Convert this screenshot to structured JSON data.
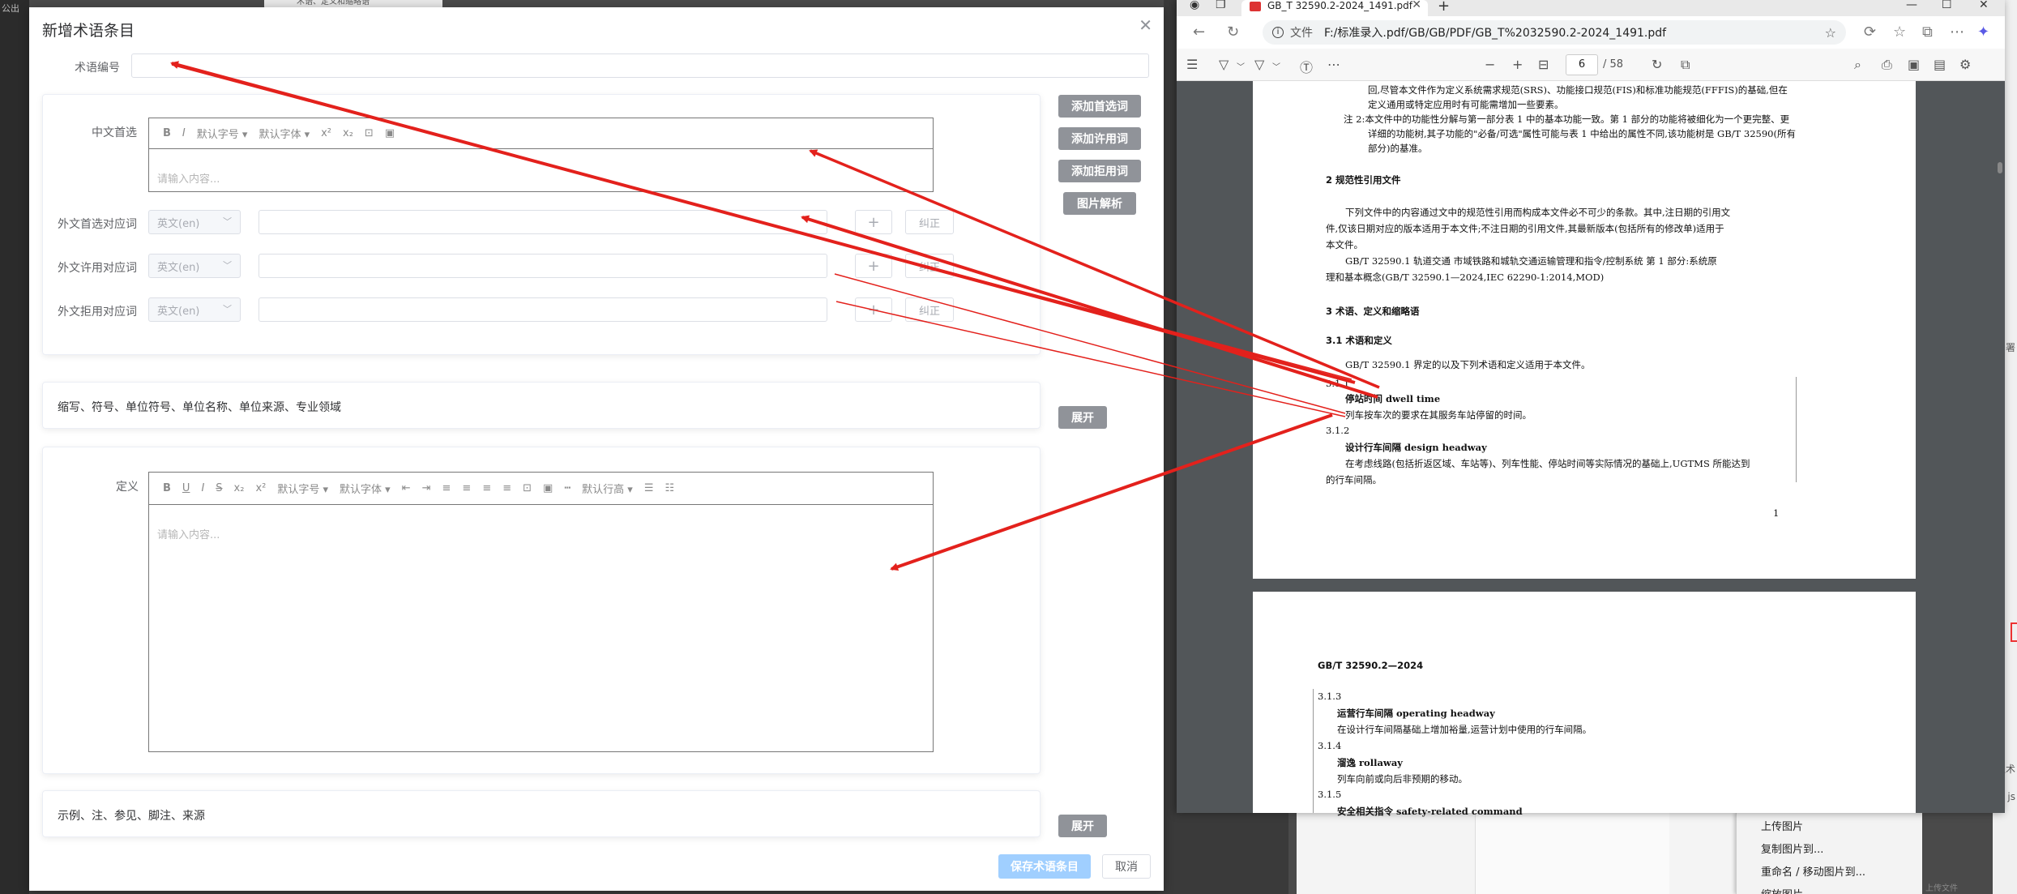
{
  "background": {
    "left_label": "公出",
    "tab_label": "术语、定义和缩略语",
    "ctx_menu": [
      "上传图片",
      "复制图片到...",
      "重命名 / 移动图片到...",
      "缩放图片"
    ],
    "right_strip": [
      "署",
      "之术",
      "js"
    ],
    "bottom_note": "上传文件"
  },
  "dialog": {
    "title": "新增术语条目",
    "close_icon": "close-icon",
    "term_number_label": "术语编号",
    "zh_preferred_label": "中文首选",
    "editor_placeholder": "请输入内容...",
    "toolbar1": [
      "B",
      "I",
      "默认字号 ▾",
      "默认字体 ▾",
      "x²",
      "x₂",
      "⊡",
      "▣"
    ],
    "foreign_rows": [
      {
        "label": "外文首选对应词",
        "lang": "英文(en)",
        "add": "+",
        "fix": "纠正"
      },
      {
        "label": "外文许用对应词",
        "lang": "英文(en)",
        "add": "+",
        "fix": "纠正"
      },
      {
        "label": "外文拒用对应词",
        "lang": "英文(en)",
        "add": "+",
        "fix": "纠正"
      }
    ],
    "side_buttons": [
      "添加首选词",
      "添加许用词",
      "添加拒用词",
      "图片解析"
    ],
    "abbrev_section": "缩写、符号、单位符号、单位名称、单位来源、专业领域",
    "expand_label": "展开",
    "definition_label": "定义",
    "toolbar2": [
      "B",
      "U",
      "I",
      "S",
      "x₂",
      "x²",
      "默认字号 ▾",
      "默认字体 ▾",
      "⇤",
      "⇥",
      "≡",
      "≡",
      "≡",
      "≡",
      "⊡",
      "▣",
      "┅",
      "默认行高 ▾",
      "☰",
      "☷"
    ],
    "examples_section": "示例、注、参见、脚注、来源",
    "save_label": "保存术语条目",
    "cancel_label": "取消"
  },
  "pdf": {
    "tab_title": "GB_T 32590.2-2024_1491.pdf",
    "file_label": "文件",
    "url": "F:/标准录入.pdf/GB/GB/PDF/GB_T%2032590.2-2024_1491.pdf",
    "page_current": "6",
    "page_total": "/ 58",
    "page1_lines": [
      "回,尽管本文件作为定义系统需求规范(SRS)、功能接口规范(FIS)和标准功能规范(FFFIS)的基础,但在",
      "定义通用或特定应用时有可能需增加一些要素。",
      "注 2:本文件中的功能性分解与第一部分表 1 中的基本功能一致。第 1 部分的功能将被细化为一个更完整、更",
      "详细的功能树,其子功能的\"必备/可选\"属性可能与表 1 中给出的属性不同,该功能树是 GB/T 32590(所有",
      "部分)的基准。"
    ],
    "sec2_title": "2   规范性引用文件",
    "sec2_p1": [
      "下列文件中的内容通过文中的规范性引用而构成本文件必不可少的条款。其中,注日期的引用文",
      "件,仅该日期对应的版本适用于本文件;不注日期的引用文件,其最新版本(包括所有的修改单)适用于",
      "本文件。"
    ],
    "sec2_p2": [
      "GB/T 32590.1   轨道交通   市域铁路和城轨交通运输管理和指令/控制系统   第 1 部分:系统原",
      "理和基本概念(GB/T 32590.1—2024,IEC 62290-1:2014,MOD)"
    ],
    "sec3_title": "3   术语、定义和缩略语",
    "sec31_title": "3.1   术语和定义",
    "sec31_intro": "GB/T 32590.1 界定的以及下列术语和定义适用于本文件。",
    "terms_page1": [
      {
        "num": "3.1.1",
        "term": "停站时间     dwell time",
        "def": [
          "列车按车次的要求在其服务车站停留的时间。"
        ]
      },
      {
        "num": "3.1.2",
        "term": "设计行车间隔     design headway",
        "def": [
          "在考虑线路(包括折返区域、车站等)、列车性能、停站时间等实际情况的基础上,UGTMS 所能达到",
          "的行车间隔。"
        ]
      }
    ],
    "page1_number": "1",
    "page2_header": "GB/T 32590.2—2024",
    "terms_page2": [
      {
        "num": "3.1.3",
        "term": "运营行车间隔     operating headway",
        "def": [
          "在设计行车间隔基础上增加裕量,运营计划中使用的行车间隔。"
        ]
      },
      {
        "num": "3.1.4",
        "term": "溜逸     rollaway",
        "def": [
          "列车向前或向后非预期的移动。"
        ]
      },
      {
        "num": "3.1.5",
        "term": "安全相关指令     safety-related command",
        "def": []
      }
    ]
  }
}
